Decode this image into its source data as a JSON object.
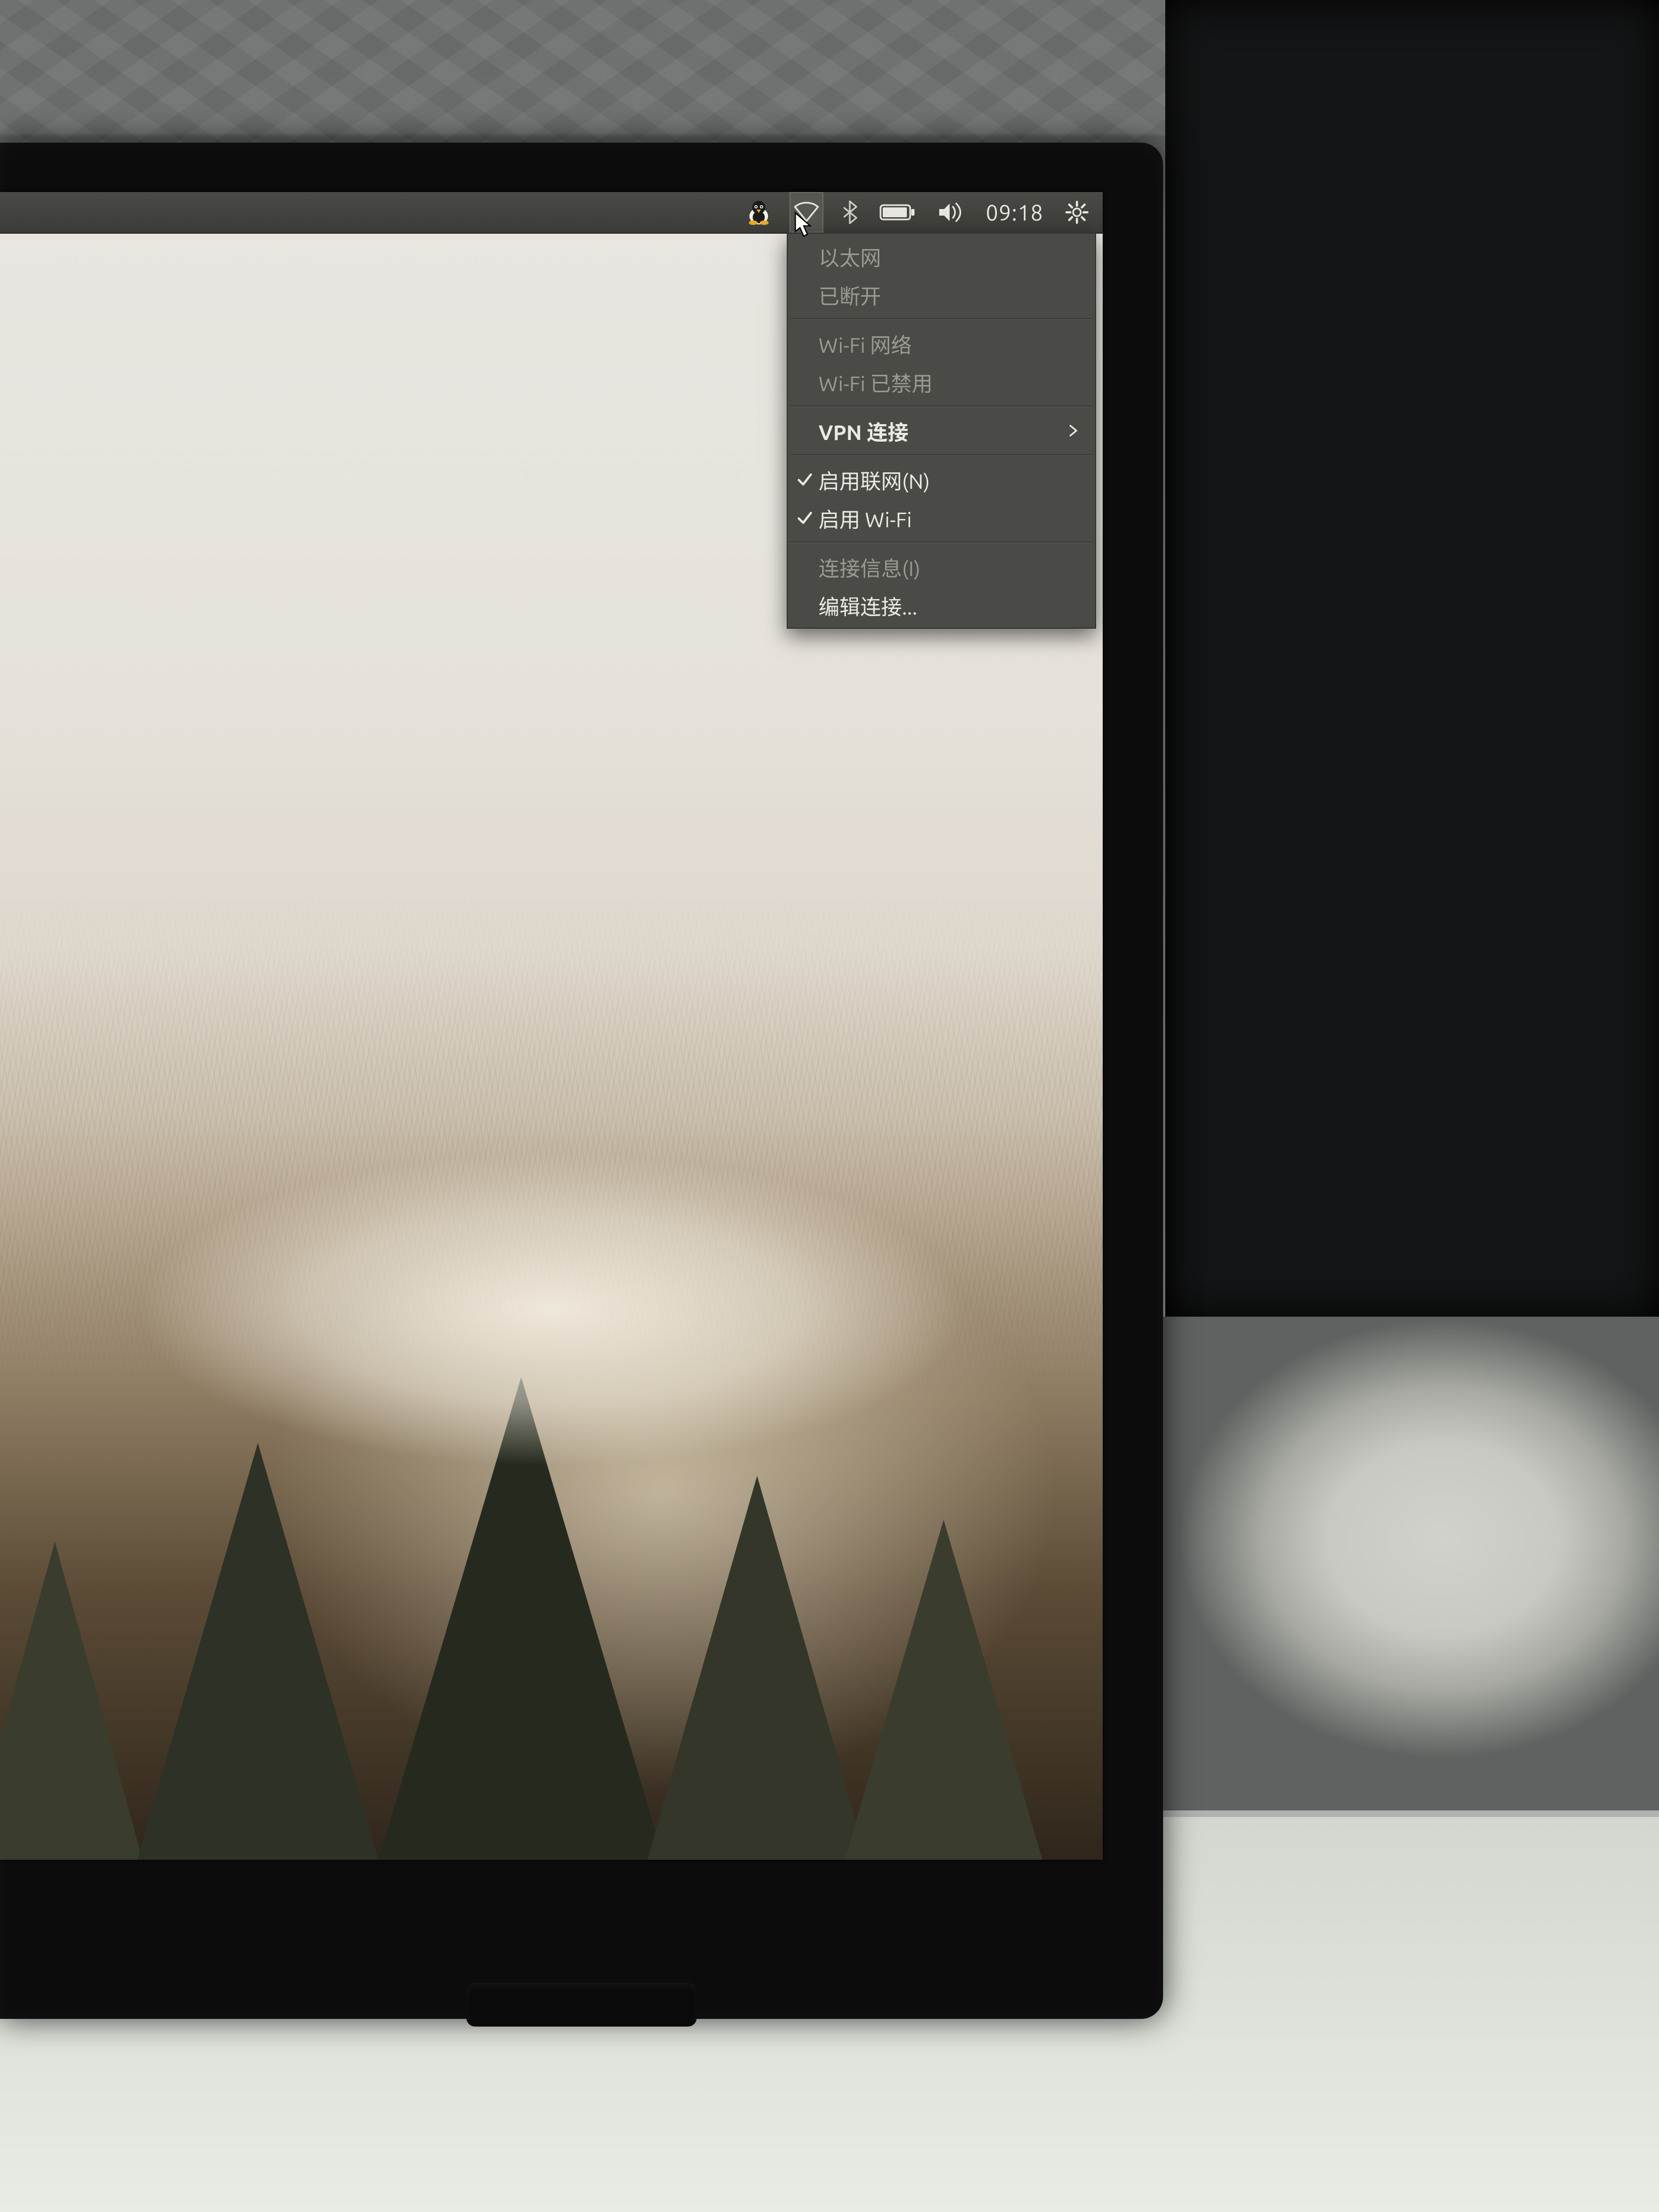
{
  "menubar": {
    "clock": "09:18"
  },
  "network_menu": {
    "ethernet_header": "以太网",
    "ethernet_status": "已断开",
    "wifi_header": "Wi-Fi 网络",
    "wifi_status": "Wi-Fi 已禁用",
    "vpn": "VPN 连接",
    "enable_networking": "启用联网(N)",
    "enable_wifi": "启用 Wi-Fi",
    "connection_info": "连接信息(I)",
    "edit_connections": "编辑连接..."
  }
}
